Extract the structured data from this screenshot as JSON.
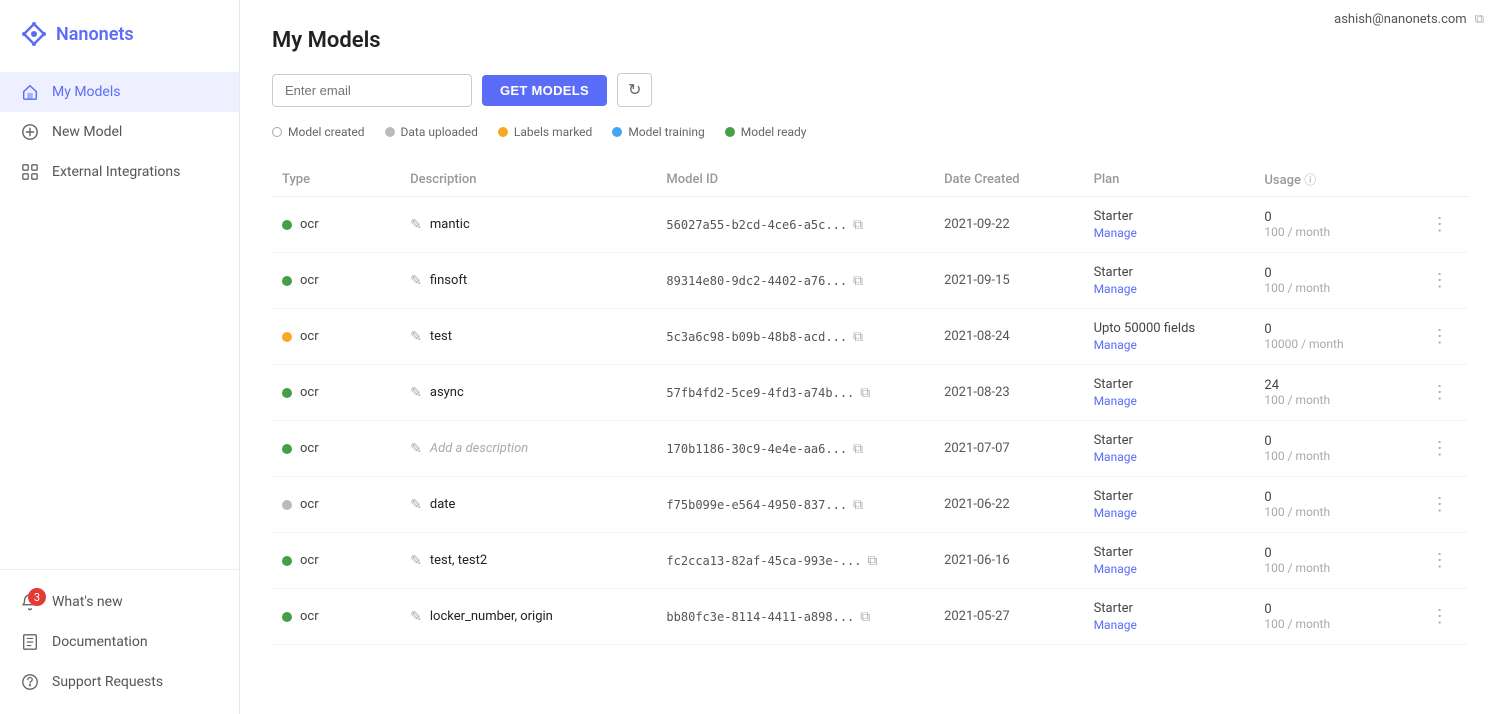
{
  "app": {
    "name": "Nanonets"
  },
  "header": {
    "user_email": "ashish@nanonets.com"
  },
  "sidebar": {
    "nav_items": [
      {
        "id": "my-models",
        "label": "My Models",
        "active": true
      },
      {
        "id": "new-model",
        "label": "New Model",
        "active": false
      },
      {
        "id": "external-integrations",
        "label": "External Integrations",
        "active": false
      }
    ],
    "bottom_items": [
      {
        "id": "whats-new",
        "label": "What's new",
        "badge": "3"
      },
      {
        "id": "documentation",
        "label": "Documentation"
      },
      {
        "id": "support-requests",
        "label": "Support Requests"
      }
    ]
  },
  "page": {
    "title": "My Models"
  },
  "toolbar": {
    "email_placeholder": "Enter email",
    "get_models_label": "GET MODELS",
    "refresh_icon": "↻"
  },
  "legend": {
    "items": [
      {
        "id": "model-created",
        "label": "Model created",
        "dot": "empty"
      },
      {
        "id": "data-uploaded",
        "label": "Data uploaded",
        "dot": "gray"
      },
      {
        "id": "labels-marked",
        "label": "Labels marked",
        "dot": "yellow"
      },
      {
        "id": "model-training",
        "label": "Model training",
        "dot": "blue"
      },
      {
        "id": "model-ready",
        "label": "Model ready",
        "dot": "green"
      }
    ]
  },
  "table": {
    "columns": [
      "Type",
      "Description",
      "Model ID",
      "Date Created",
      "Plan",
      "Usage"
    ],
    "rows": [
      {
        "status": "green",
        "type": "ocr",
        "description": "mantic",
        "is_placeholder": false,
        "model_id": "56027a55-b2cd-4ce6-a5c...",
        "date_created": "2021-09-22",
        "plan": "Starter",
        "usage_count": "0",
        "usage_limit": "100 / month"
      },
      {
        "status": "green",
        "type": "ocr",
        "description": "finsoft",
        "is_placeholder": false,
        "model_id": "89314e80-9dc2-4402-a76...",
        "date_created": "2021-09-15",
        "plan": "Starter",
        "usage_count": "0",
        "usage_limit": "100 / month"
      },
      {
        "status": "yellow",
        "type": "ocr",
        "description": "test",
        "is_placeholder": false,
        "model_id": "5c3a6c98-b09b-48b8-acd...",
        "date_created": "2021-08-24",
        "plan": "Upto 50000 fields",
        "usage_count": "0",
        "usage_limit": "10000 / month"
      },
      {
        "status": "green",
        "type": "ocr",
        "description": "async",
        "is_placeholder": false,
        "model_id": "57fb4fd2-5ce9-4fd3-a74b...",
        "date_created": "2021-08-23",
        "plan": "Starter",
        "usage_count": "24",
        "usage_limit": "100 / month"
      },
      {
        "status": "green",
        "type": "ocr",
        "description": "Add a description",
        "is_placeholder": true,
        "model_id": "170b1186-30c9-4e4e-aa6...",
        "date_created": "2021-07-07",
        "plan": "Starter",
        "usage_count": "0",
        "usage_limit": "100 / month"
      },
      {
        "status": "gray",
        "type": "ocr",
        "description": "date",
        "is_placeholder": false,
        "model_id": "f75b099e-e564-4950-837...",
        "date_created": "2021-06-22",
        "plan": "Starter",
        "usage_count": "0",
        "usage_limit": "100 / month"
      },
      {
        "status": "green",
        "type": "ocr",
        "description": "test, test2",
        "is_placeholder": false,
        "model_id": "fc2cca13-82af-45ca-993e-...",
        "date_created": "2021-06-16",
        "plan": "Starter",
        "usage_count": "0",
        "usage_limit": "100 / month"
      },
      {
        "status": "green",
        "type": "ocr",
        "description": "locker_number, origin",
        "is_placeholder": false,
        "model_id": "bb80fc3e-8114-4411-a898...",
        "date_created": "2021-05-27",
        "plan": "Starter",
        "usage_count": "0",
        "usage_limit": "100 / month"
      }
    ],
    "manage_label": "Manage"
  }
}
